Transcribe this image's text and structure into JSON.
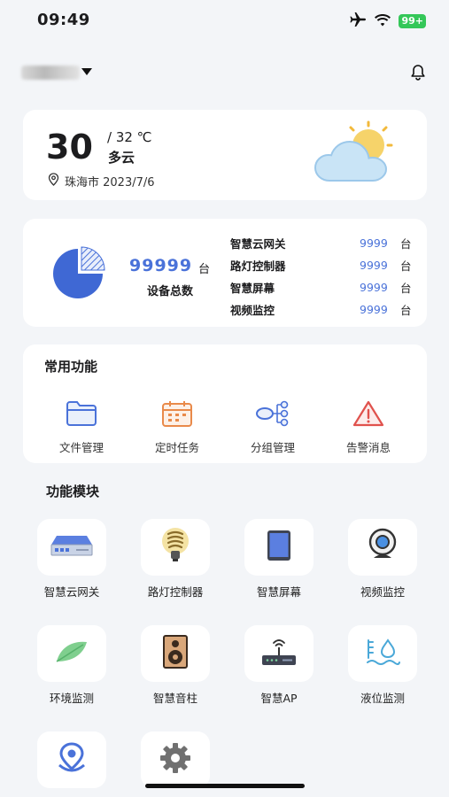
{
  "status_bar": {
    "time": "09:49",
    "battery": "99+"
  },
  "colors": {
    "accent": "#4a72d9",
    "background": "#f3f5f8",
    "warning": "#e0524d",
    "orange": "#e98a4a"
  },
  "weather": {
    "temperature": "30",
    "range": "/ 32 ℃",
    "condition": "多云",
    "location": "珠海市 2023/7/6",
    "icon": "partly-cloudy-icon"
  },
  "stats": {
    "total_value": "99999",
    "total_unit": "台",
    "total_label": "设备总数",
    "devices": [
      {
        "name": "智慧云网关",
        "count": "9999",
        "unit": "台"
      },
      {
        "name": "路灯控制器",
        "count": "9999",
        "unit": "台"
      },
      {
        "name": "智慧屏幕",
        "count": "9999",
        "unit": "台"
      },
      {
        "name": "视频监控",
        "count": "9999",
        "unit": "台"
      }
    ]
  },
  "common": {
    "title": "常用功能",
    "items": [
      {
        "label": "文件管理",
        "icon": "folder-icon"
      },
      {
        "label": "定时任务",
        "icon": "calendar-icon"
      },
      {
        "label": "分组管理",
        "icon": "group-tree-icon"
      },
      {
        "label": "告警消息",
        "icon": "warning-icon"
      }
    ]
  },
  "modules": {
    "title": "功能模块",
    "items": [
      {
        "label": "智慧云网关",
        "icon": "gateway-icon"
      },
      {
        "label": "路灯控制器",
        "icon": "bulb-icon"
      },
      {
        "label": "智慧屏幕",
        "icon": "tablet-icon"
      },
      {
        "label": "视频监控",
        "icon": "webcam-icon"
      },
      {
        "label": "环境监测",
        "icon": "leaf-icon"
      },
      {
        "label": "智慧音柱",
        "icon": "speaker-icon"
      },
      {
        "label": "智慧AP",
        "icon": "router-icon"
      },
      {
        "label": "液位监测",
        "icon": "water-level-icon"
      },
      {
        "label": "",
        "icon": "location-icon"
      },
      {
        "label": "",
        "icon": "gear-icon"
      }
    ]
  }
}
